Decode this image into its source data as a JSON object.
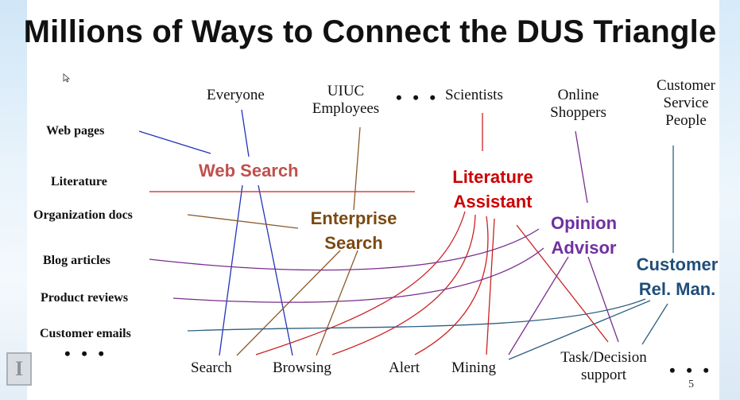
{
  "slide": {
    "title": "Millions of Ways to Connect the DUS Triangle",
    "page_number": "5"
  },
  "documents": {
    "web_pages": "Web pages",
    "literature": "Literature",
    "organization_docs": "Organization docs",
    "blog_articles": "Blog articles",
    "product_reviews": "Product reviews",
    "customer_emails": "Customer emails",
    "more": "• • •"
  },
  "users": {
    "everyone": "Everyone",
    "uiuc_line1": "UIUC",
    "uiuc_line2": "Employees",
    "more": "• • •",
    "scientists": "Scientists",
    "online_line1": "Online",
    "online_line2": "Shoppers",
    "cs_line1": "Customer",
    "cs_line2": "Service",
    "cs_line3": "People"
  },
  "systems": {
    "web_search": "Web Search",
    "enterprise_line1": "Enterprise",
    "enterprise_line2": "Search",
    "literature_line1": "Literature",
    "literature_line2": "Assistant",
    "opinion_line1": "Opinion",
    "opinion_line2": "Advisor",
    "customer_line1": "Customer",
    "customer_line2": "Rel. Man."
  },
  "tasks": {
    "search": "Search",
    "browsing": "Browsing",
    "alert": "Alert",
    "mining": "Mining",
    "task_line1": "Task/Decision",
    "task_line2": "support",
    "more": "• • •"
  },
  "colors": {
    "web_search": "#c0504d",
    "enterprise_search": "#7b4a12",
    "literature_assistant": "#cc0000",
    "opinion_advisor": "#7030a0",
    "customer_rel_man": "#1f4e79",
    "web_links": "#2233bb",
    "enterprise_links": "#8b5a2b",
    "literature_links": "#cc2222",
    "opinion_links": "#7a2e8e",
    "customer_links": "#2f5f80"
  }
}
